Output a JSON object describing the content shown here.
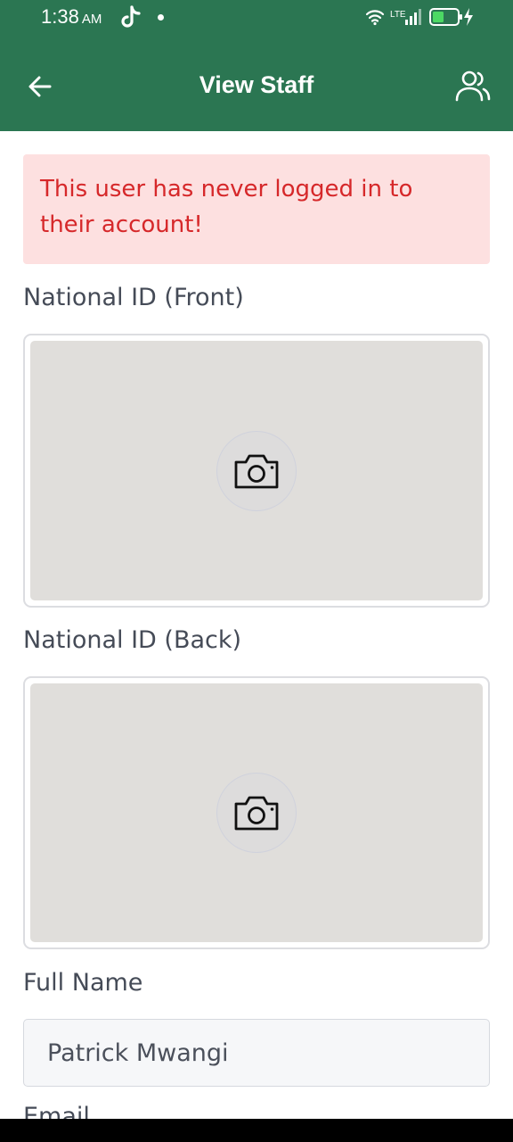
{
  "status_bar": {
    "time": "1:38",
    "ampm": "AM",
    "network": "LTE"
  },
  "header": {
    "title": "View Staff"
  },
  "alert": {
    "message": "This user has never logged in to their account!"
  },
  "fields": {
    "id_front_label": "National ID (Front)",
    "id_back_label": "National ID (Back)",
    "full_name_label": "Full Name",
    "full_name_value": "Patrick Mwangi",
    "email_label": "Email"
  },
  "icons": {
    "back": "arrow-left-icon",
    "staff": "users-icon",
    "camera": "camera-icon"
  },
  "colors": {
    "primary": "#2b7652",
    "alert_bg": "#fde0e0",
    "alert_text": "#d6282a",
    "photo_placeholder": "#e0dedb"
  }
}
